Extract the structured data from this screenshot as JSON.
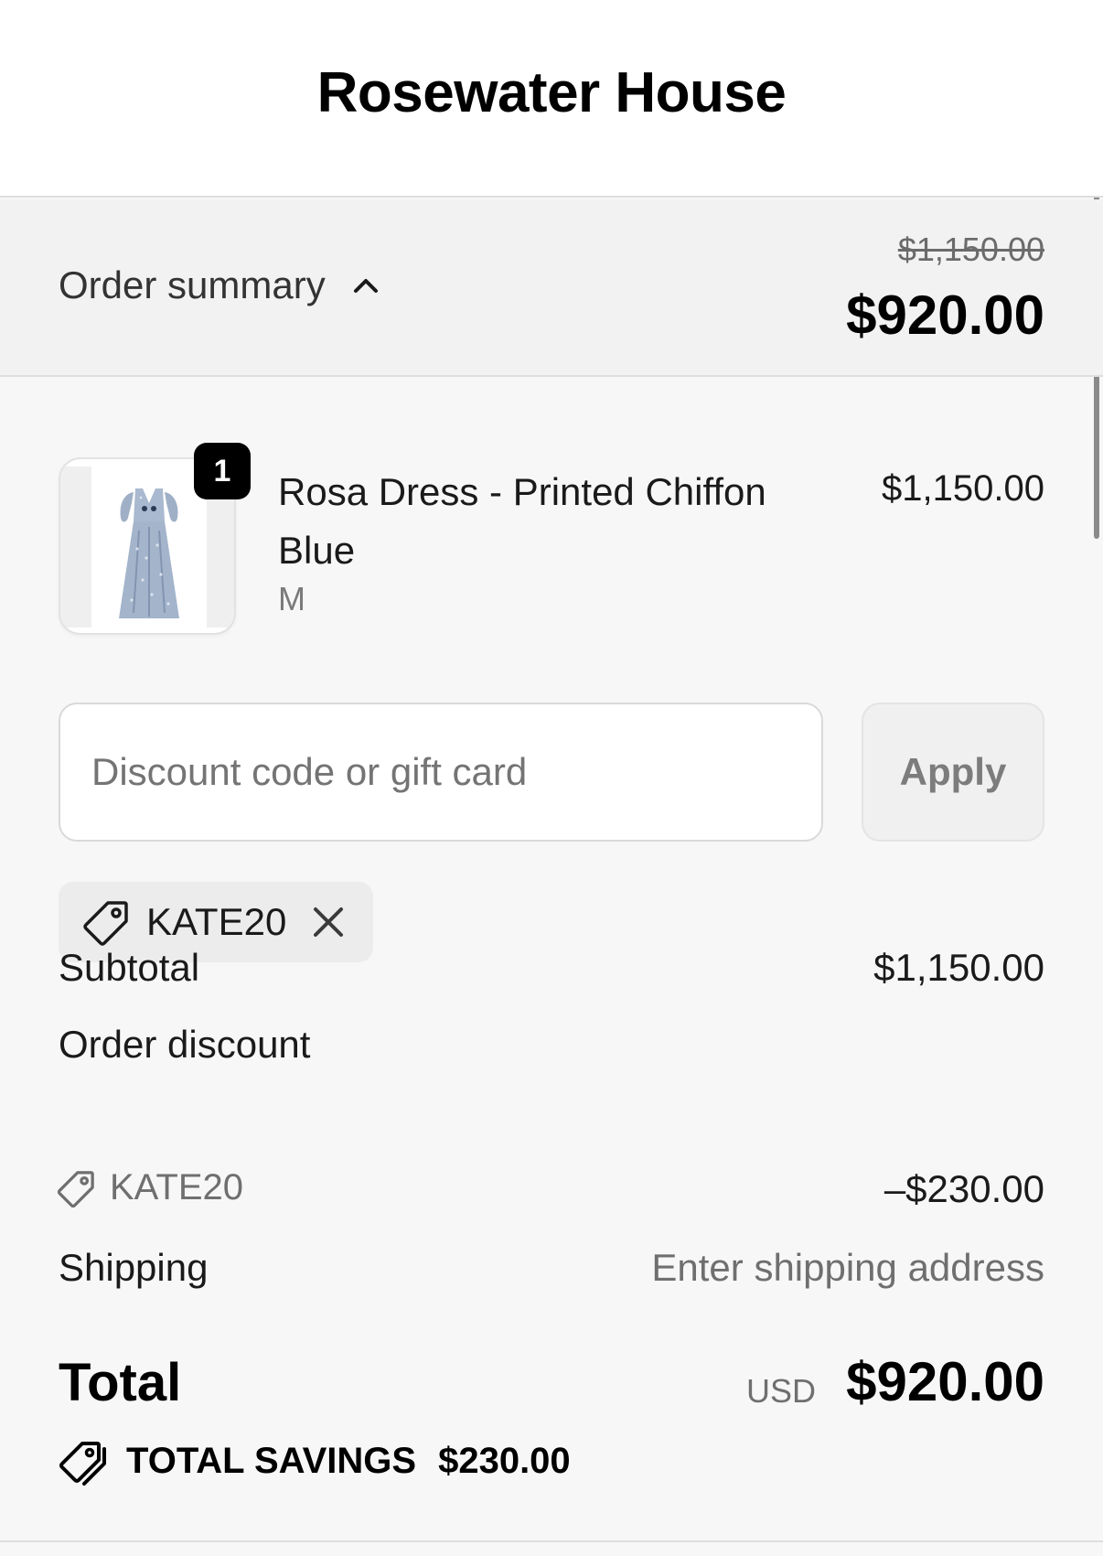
{
  "header": {
    "store_name": "Rosewater House"
  },
  "summary_bar": {
    "toggle_label": "Order summary",
    "original_total": "$1,150.00",
    "current_total": "$920.00"
  },
  "product": {
    "quantity": "1",
    "name": "Rosa Dress - Printed Chiffon Blue",
    "variant": "M",
    "price": "$1,150.00",
    "image_icon": "dress-thumbnail"
  },
  "discount": {
    "placeholder": "Discount code or gift card",
    "apply_label": "Apply",
    "applied_code": "KATE20"
  },
  "lines": {
    "subtotal_label": "Subtotal",
    "subtotal_value": "$1,150.00",
    "discount_label": "Order discount",
    "discount_code": "KATE20",
    "discount_value": "–$230.00",
    "shipping_label": "Shipping",
    "shipping_value": "Enter shipping address"
  },
  "total": {
    "label": "Total",
    "currency": "USD",
    "value": "$920.00"
  },
  "savings": {
    "label": "TOTAL SAVINGS",
    "amount": "$230.00"
  },
  "colors": {
    "background": "#f7f7f7",
    "header_bg": "#ffffff",
    "summary_bg": "#f2f2f2",
    "badge": "#000000",
    "muted_text": "#6f6f6f"
  }
}
